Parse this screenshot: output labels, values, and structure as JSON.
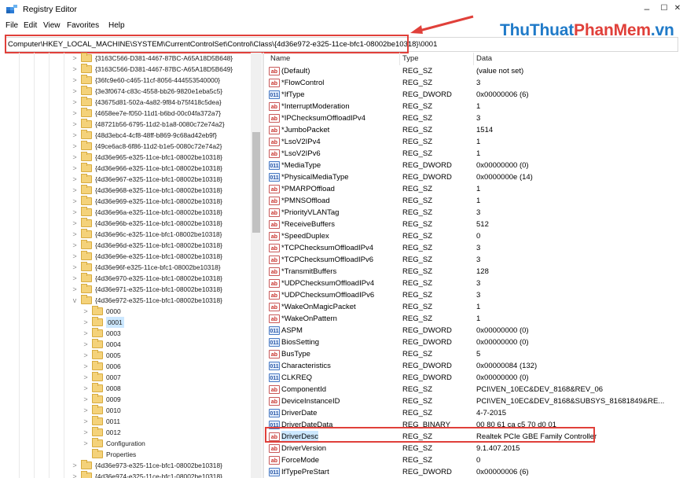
{
  "window": {
    "title": "Registry Editor",
    "controls": {
      "minimize": "–",
      "maximize": "☐",
      "close": "✕"
    }
  },
  "menu": [
    "File",
    "Edit",
    "View",
    "Favorites",
    "Help"
  ],
  "brand": {
    "part1": "ThuThuat",
    "part2": "PhanMem",
    "part3": ".vn"
  },
  "address": {
    "value": "Computer\\HKEY_LOCAL_MACHINE\\SYSTEM\\CurrentControlSet\\Control\\Class\\{4d36e972-e325-11ce-bfc1-08002be10318}\\0001"
  },
  "tree": [
    {
      "label": "{3163C566-D381-4467-87BC-A65A18D5B648}",
      "level": 0,
      "twisty": ">"
    },
    {
      "label": "{3163C566-D381-4467-87BC-A65A18D5B649}",
      "level": 0,
      "twisty": ">"
    },
    {
      "label": "{36fc9e60-c465-11cf-8056-444553540000}",
      "level": 0,
      "twisty": ">"
    },
    {
      "label": "{3e3f0674-c83c-4558-bb26-9820e1eba5c5}",
      "level": 0,
      "twisty": ">"
    },
    {
      "label": "{43675d81-502a-4a82-9f84-b75f418c5dea}",
      "level": 0,
      "twisty": ">"
    },
    {
      "label": "{4658ee7e-f050-11d1-b6bd-00c04fa372a7}",
      "level": 0,
      "twisty": ">"
    },
    {
      "label": "{48721b56-6795-11d2-b1a8-0080c72e74a2}",
      "level": 0,
      "twisty": ">"
    },
    {
      "label": "{48d3ebc4-4cf8-48ff-b869-9c68ad42eb9f}",
      "level": 0,
      "twisty": ">"
    },
    {
      "label": "{49ce6ac8-6f86-11d2-b1e5-0080c72e74a2}",
      "level": 0,
      "twisty": ">"
    },
    {
      "label": "{4d36e965-e325-11ce-bfc1-08002be10318}",
      "level": 0,
      "twisty": ">"
    },
    {
      "label": "{4d36e966-e325-11ce-bfc1-08002be10318}",
      "level": 0,
      "twisty": ">"
    },
    {
      "label": "{4d36e967-e325-11ce-bfc1-08002be10318}",
      "level": 0,
      "twisty": ">"
    },
    {
      "label": "{4d36e968-e325-11ce-bfc1-08002be10318}",
      "level": 0,
      "twisty": ">"
    },
    {
      "label": "{4d36e969-e325-11ce-bfc1-08002be10318}",
      "level": 0,
      "twisty": ">"
    },
    {
      "label": "{4d36e96a-e325-11ce-bfc1-08002be10318}",
      "level": 0,
      "twisty": ">"
    },
    {
      "label": "{4d36e96b-e325-11ce-bfc1-08002be10318}",
      "level": 0,
      "twisty": ">"
    },
    {
      "label": "{4d36e96c-e325-11ce-bfc1-08002be10318}",
      "level": 0,
      "twisty": ">"
    },
    {
      "label": "{4d36e96d-e325-11ce-bfc1-08002be10318}",
      "level": 0,
      "twisty": ">"
    },
    {
      "label": "{4d36e96e-e325-11ce-bfc1-08002be10318}",
      "level": 0,
      "twisty": ">"
    },
    {
      "label": "{4d36e96f-e325-11ce-bfc1-08002be10318}",
      "level": 0,
      "twisty": ">"
    },
    {
      "label": "{4d36e970-e325-11ce-bfc1-08002be10318}",
      "level": 0,
      "twisty": ">"
    },
    {
      "label": "{4d36e971-e325-11ce-bfc1-08002be10318}",
      "level": 0,
      "twisty": ">"
    },
    {
      "label": "{4d36e972-e325-11ce-bfc1-08002be10318}",
      "level": 0,
      "twisty": "v"
    },
    {
      "label": "0000",
      "level": 1,
      "twisty": ">"
    },
    {
      "label": "0001",
      "level": 1,
      "twisty": ">",
      "selected": true
    },
    {
      "label": "0003",
      "level": 1,
      "twisty": ">"
    },
    {
      "label": "0004",
      "level": 1,
      "twisty": ">"
    },
    {
      "label": "0005",
      "level": 1,
      "twisty": ">"
    },
    {
      "label": "0006",
      "level": 1,
      "twisty": ">"
    },
    {
      "label": "0007",
      "level": 1,
      "twisty": ">"
    },
    {
      "label": "0008",
      "level": 1,
      "twisty": ">"
    },
    {
      "label": "0009",
      "level": 1,
      "twisty": ">"
    },
    {
      "label": "0010",
      "level": 1,
      "twisty": ">"
    },
    {
      "label": "0011",
      "level": 1,
      "twisty": ">"
    },
    {
      "label": "0012",
      "level": 1,
      "twisty": ">"
    },
    {
      "label": "Configuration",
      "level": 1,
      "twisty": ">"
    },
    {
      "label": "Properties",
      "level": 1,
      "twisty": ""
    },
    {
      "label": "{4d36e973-e325-11ce-bfc1-08002be10318}",
      "level": 0,
      "twisty": ">"
    },
    {
      "label": "{4d36e974-e325-11ce-bfc1-08002be10318}",
      "level": 0,
      "twisty": ">"
    }
  ],
  "columns": {
    "name": "Name",
    "type": "Type",
    "data": "Data"
  },
  "values": [
    {
      "icon": "ab",
      "name": "(Default)",
      "type": "REG_SZ",
      "data": "(value not set)"
    },
    {
      "icon": "ab",
      "name": "*FlowControl",
      "type": "REG_SZ",
      "data": "3"
    },
    {
      "icon": "bin",
      "name": "*IfType",
      "type": "REG_DWORD",
      "data": "0x00000006 (6)"
    },
    {
      "icon": "ab",
      "name": "*InterruptModeration",
      "type": "REG_SZ",
      "data": "1"
    },
    {
      "icon": "ab",
      "name": "*IPChecksumOffloadIPv4",
      "type": "REG_SZ",
      "data": "3"
    },
    {
      "icon": "ab",
      "name": "*JumboPacket",
      "type": "REG_SZ",
      "data": "1514"
    },
    {
      "icon": "ab",
      "name": "*LsoV2IPv4",
      "type": "REG_SZ",
      "data": "1"
    },
    {
      "icon": "ab",
      "name": "*LsoV2IPv6",
      "type": "REG_SZ",
      "data": "1"
    },
    {
      "icon": "bin",
      "name": "*MediaType",
      "type": "REG_DWORD",
      "data": "0x00000000 (0)"
    },
    {
      "icon": "bin",
      "name": "*PhysicalMediaType",
      "type": "REG_DWORD",
      "data": "0x0000000e (14)"
    },
    {
      "icon": "ab",
      "name": "*PMARPOffload",
      "type": "REG_SZ",
      "data": "1"
    },
    {
      "icon": "ab",
      "name": "*PMNSOffload",
      "type": "REG_SZ",
      "data": "1"
    },
    {
      "icon": "ab",
      "name": "*PriorityVLANTag",
      "type": "REG_SZ",
      "data": "3"
    },
    {
      "icon": "ab",
      "name": "*ReceiveBuffers",
      "type": "REG_SZ",
      "data": "512"
    },
    {
      "icon": "ab",
      "name": "*SpeedDuplex",
      "type": "REG_SZ",
      "data": "0"
    },
    {
      "icon": "ab",
      "name": "*TCPChecksumOffloadIPv4",
      "type": "REG_SZ",
      "data": "3"
    },
    {
      "icon": "ab",
      "name": "*TCPChecksumOffloadIPv6",
      "type": "REG_SZ",
      "data": "3"
    },
    {
      "icon": "ab",
      "name": "*TransmitBuffers",
      "type": "REG_SZ",
      "data": "128"
    },
    {
      "icon": "ab",
      "name": "*UDPChecksumOffloadIPv4",
      "type": "REG_SZ",
      "data": "3"
    },
    {
      "icon": "ab",
      "name": "*UDPChecksumOffloadIPv6",
      "type": "REG_SZ",
      "data": "3"
    },
    {
      "icon": "ab",
      "name": "*WakeOnMagicPacket",
      "type": "REG_SZ",
      "data": "1"
    },
    {
      "icon": "ab",
      "name": "*WakeOnPattern",
      "type": "REG_SZ",
      "data": "1"
    },
    {
      "icon": "bin",
      "name": "ASPM",
      "type": "REG_DWORD",
      "data": "0x00000000 (0)"
    },
    {
      "icon": "bin",
      "name": "BiosSetting",
      "type": "REG_DWORD",
      "data": "0x00000000 (0)"
    },
    {
      "icon": "ab",
      "name": "BusType",
      "type": "REG_SZ",
      "data": "5"
    },
    {
      "icon": "bin",
      "name": "Characteristics",
      "type": "REG_DWORD",
      "data": "0x00000084 (132)"
    },
    {
      "icon": "bin",
      "name": "CLKREQ",
      "type": "REG_DWORD",
      "data": "0x00000000 (0)"
    },
    {
      "icon": "ab",
      "name": "ComponentId",
      "type": "REG_SZ",
      "data": "PCI\\VEN_10EC&DEV_8168&REV_06"
    },
    {
      "icon": "ab",
      "name": "DeviceInstanceID",
      "type": "REG_SZ",
      "data": "PCI\\VEN_10EC&DEV_8168&SUBSYS_81681849&RE..."
    },
    {
      "icon": "bin",
      "name": "DriverDate",
      "type": "REG_SZ",
      "data": "4-7-2015"
    },
    {
      "icon": "bin",
      "name": "DriverDateData",
      "type": "REG_BINARY",
      "data": "00 80 61 ca c5 70 d0 01"
    },
    {
      "icon": "ab",
      "name": "DriverDesc",
      "type": "REG_SZ",
      "data": "Realtek PCIe GBE Family Controller",
      "selected": true
    },
    {
      "icon": "ab",
      "name": "DriverVersion",
      "type": "REG_SZ",
      "data": "9.1.407.2015"
    },
    {
      "icon": "ab",
      "name": "ForceMode",
      "type": "REG_SZ",
      "data": "0"
    },
    {
      "icon": "bin",
      "name": "IfTypePreStart",
      "type": "REG_DWORD",
      "data": "0x00000006 (6)"
    }
  ]
}
